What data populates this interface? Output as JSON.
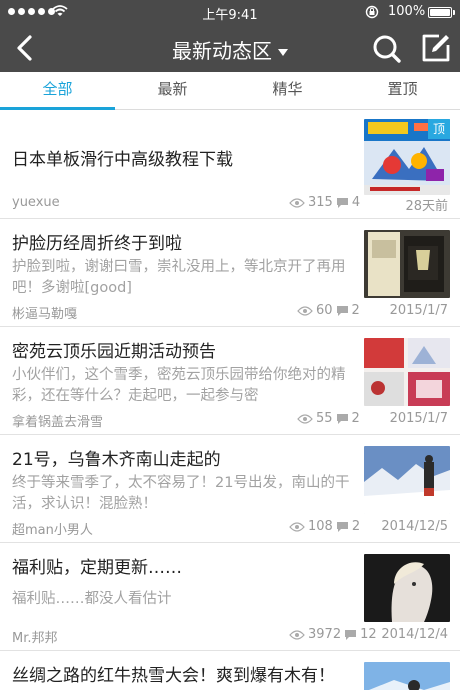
{
  "status_bar": {
    "time": "上午9:41",
    "battery": "100%"
  },
  "nav": {
    "title": "最新动态区"
  },
  "tabs": [
    {
      "label": "全部",
      "active": true
    },
    {
      "label": "最新",
      "active": false
    },
    {
      "label": "精华",
      "active": false
    },
    {
      "label": "置顶",
      "active": false
    }
  ],
  "posts": [
    {
      "title": "日本单板滑行中高级教程下载",
      "excerpt": "",
      "author": "yuexue",
      "views": "315",
      "comments": "4",
      "date": "28天前",
      "pinned_label": "顶"
    },
    {
      "title": "护脸历经周折终于到啦",
      "excerpt": "护脸到啦，谢谢曰雪，崇礼没用上，等北京开了再用吧！多谢啦[good]",
      "author": "彬逼马勒嘎",
      "views": "60",
      "comments": "2",
      "date": "2015/1/7"
    },
    {
      "title": "密苑云顶乐园近期活动预告",
      "excerpt": "小伙伴们，这个雪季，密苑云顶乐园带给你绝对的精彩，还在等什么？走起吧，一起参与密",
      "author": "拿着锅盖去滑雪",
      "views": "55",
      "comments": "2",
      "date": "2015/1/7"
    },
    {
      "title": "21号，乌鲁木齐南山走起的",
      "excerpt": "终于等来雪季了，太不容易了！21号出发，南山的干活，求认识！混脸熟！",
      "author": "超man小男人",
      "views": "108",
      "comments": "2",
      "date": "2014/12/5"
    },
    {
      "title": "福利贴，定期更新……",
      "excerpt": "福利贴……都没人看估计",
      "author": "Mr.邦邦",
      "views": "3972",
      "comments": "12",
      "date": "2014/12/4"
    },
    {
      "title": "丝绸之路的红牛热雪大会！爽到爆有木有！",
      "excerpt": "",
      "author": "",
      "views": "",
      "comments": "",
      "date": ""
    }
  ],
  "colors": {
    "accent": "#1aa3d9",
    "bar": "#4a4a4a"
  }
}
